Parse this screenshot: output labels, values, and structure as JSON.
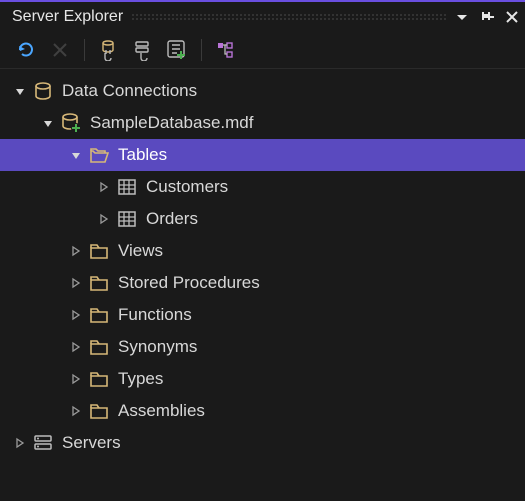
{
  "panel": {
    "title": "Server Explorer"
  },
  "toolbar": {
    "refresh": "Refresh",
    "stop": "Stop",
    "connect_db": "Connect to Database",
    "connect_srv": "Connect to Server",
    "add_services": "Connected Services",
    "sort": "Sort"
  },
  "tree": {
    "data_connections": "Data Connections",
    "database": "SampleDatabase.mdf",
    "tables": "Tables",
    "customers": "Customers",
    "orders": "Orders",
    "views": "Views",
    "stored_procedures": "Stored Procedures",
    "functions": "Functions",
    "synonyms": "Synonyms",
    "types": "Types",
    "assemblies": "Assemblies",
    "servers": "Servers"
  }
}
